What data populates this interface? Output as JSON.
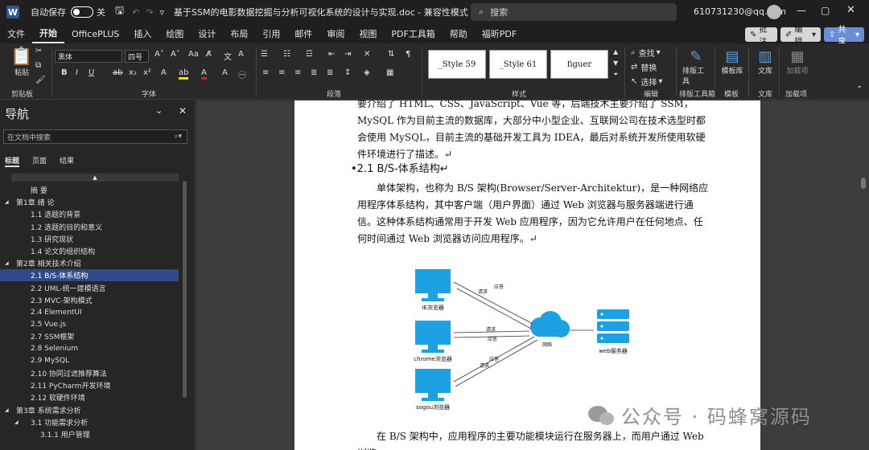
{
  "titlebar": {
    "app_letter": "W",
    "autosave_label": "自动保存",
    "autosave_state": "关",
    "doc_title": "基于SSM的电影数据挖掘与分析可视化系统的设计与实现.doc  -  兼容性模式 • 已保存",
    "search_placeholder": "搜索",
    "account": "610731230@qq.com"
  },
  "menubar": {
    "items": [
      "文件",
      "开始",
      "OfficePLUS",
      "插入",
      "绘图",
      "设计",
      "布局",
      "引用",
      "邮件",
      "审阅",
      "视图",
      "PDF工具箱",
      "帮助",
      "福昕PDF"
    ],
    "comment_label": "批注",
    "edit_label": "编辑",
    "share_label": "共享"
  },
  "ribbon": {
    "paste_label": "粘贴",
    "clipboard_label": "剪贴板",
    "font_name": "黑体",
    "font_size": "四号",
    "font_label": "字体",
    "paragraph_label": "段落",
    "styles": [
      "_Style 59",
      "_Style 61",
      "figuer"
    ],
    "styles_label": "样式",
    "find_label": "查找",
    "replace_label": "替换",
    "select_label": "选择",
    "editing_label": "编辑",
    "typeset_tool_label": "排版工具",
    "typeset_group_label": "排版工具箱",
    "template_label": "模板库",
    "template_group_label": "模板",
    "library_label": "文库",
    "library_group_label": "文库",
    "addin_label": "加载项",
    "addins_group_label": "加载项"
  },
  "nav": {
    "title": "导航",
    "search_placeholder": "在文档中搜索",
    "tabs": [
      "标题",
      "页面",
      "结果"
    ],
    "items": [
      {
        "label": "摘  要",
        "level": 1,
        "expander": ""
      },
      {
        "label": "第1章 绪 论",
        "level": 0,
        "expander": "◢"
      },
      {
        "label": "1.1  选题的背景",
        "level": 1,
        "expander": ""
      },
      {
        "label": "1.2  选题的目的和意义",
        "level": 1,
        "expander": ""
      },
      {
        "label": "1.3  研究现状",
        "level": 1,
        "expander": ""
      },
      {
        "label": "1.4  论文的组织结构",
        "level": 1,
        "expander": ""
      },
      {
        "label": "第2章  相关技术介绍",
        "level": 0,
        "expander": "◢"
      },
      {
        "label": "2.1  B/S-体系结构",
        "level": 1,
        "expander": "",
        "selected": true
      },
      {
        "label": "2.2  UML-统一建模语言",
        "level": 1,
        "expander": ""
      },
      {
        "label": "2.3  MVC-架构模式",
        "level": 1,
        "expander": ""
      },
      {
        "label": "2.4  ElementUI",
        "level": 1,
        "expander": ""
      },
      {
        "label": "2.5  Vue.js",
        "level": 1,
        "expander": ""
      },
      {
        "label": "2.7  SSM框架",
        "level": 1,
        "expander": ""
      },
      {
        "label": "2.8   Selenium",
        "level": 1,
        "expander": ""
      },
      {
        "label": "2.9  MySQL",
        "level": 1,
        "expander": ""
      },
      {
        "label": "2.10  协同过滤推荐算法",
        "level": 1,
        "expander": ""
      },
      {
        "label": "2.11  PyCharm开发环境",
        "level": 1,
        "expander": ""
      },
      {
        "label": "2.12  软硬件环境",
        "level": 1,
        "expander": ""
      },
      {
        "label": "第3章  系统需求分析",
        "level": 0,
        "expander": "◢"
      },
      {
        "label": "3.1  功能需求分析",
        "level": 1,
        "expander": "◢"
      },
      {
        "label": "3.1.1  用户管理",
        "level": 2,
        "expander": ""
      }
    ]
  },
  "document": {
    "para1": "要介绍了 HTML、CSS、JavaScript、Vue 等，后端技术主要介绍了 SSM，MySQL 作为目前主流的数据库，大部分中小型企业、互联网公司在技术选型时都会使用 MySQL，目前主流的基础开发工具为 IDEA，最后对系统开发所使用软硬件环境进行了描述。↵",
    "heading": "2.1   B/S-体系结构↵",
    "para2": "单体架构，也称为 B/S 架构(Browser/Server-Architektur)，是一种网络应用程序体系结构，其中客户端（用户界面）通过 Web 浏览器与服务器端进行通信。这种体系结构通常用于开发 Web 应用程序，因为它允许用户在任何地点、任何时间通过 Web 浏览器访问应用程序。↵",
    "para3": "在 B/S 架构中，应用程序的主要功能模块运行在服务器上，而用户通过 Web 浏览",
    "figure": {
      "client1": "IE浏览器",
      "client2": "chrome浏览器",
      "client3": "sogou浏览器",
      "server": "web服务器",
      "req": "请求",
      "resp": "应答",
      "network": "网络"
    },
    "watermark": "公众号 · 码蜂窝源码"
  },
  "colors": {
    "accent_blue": "#1da1e2",
    "nav_selected": "#2e4a88",
    "word_blue": "#2b579a"
  }
}
